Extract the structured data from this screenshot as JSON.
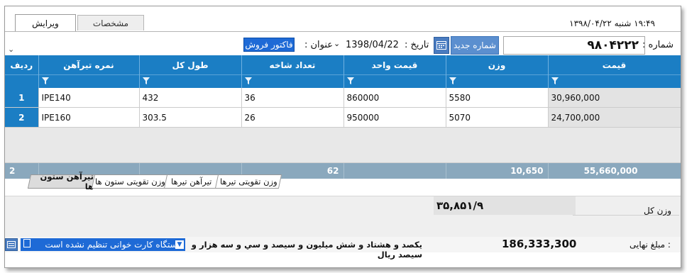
{
  "header": {
    "tabs": [
      {
        "label": "ویرایش",
        "active": true
      },
      {
        "label": "مشخصات",
        "active": false
      }
    ],
    "datetime": "۱۹:۴۹   شنبه  ۱۳۹۸/۰۴/۲۲"
  },
  "form": {
    "number_label": "شماره :",
    "number_value": "۹۸۰۴۲۲۲",
    "new_number_label": "شماره جدید",
    "date_label": "تاریخ :",
    "date_value": "1398/04/22",
    "title_label": "عنوان :",
    "title_value": "فاکتور فروش"
  },
  "grid": {
    "columns": [
      "قیمت",
      "وزن",
      "قیمت واحد",
      "تعداد شاخه",
      "طول کل",
      "نمره تیرآهن",
      "ردیف"
    ],
    "rows": [
      {
        "price": "30,960,000",
        "weight": "5580",
        "unit_price": "860000",
        "count": "36",
        "length": "432",
        "profile": "IPE140",
        "row": "1"
      },
      {
        "price": "24,700,000",
        "weight": "5070",
        "unit_price": "950000",
        "count": "26",
        "length": "303.5",
        "profile": "IPE160",
        "row": "2"
      }
    ],
    "summary": {
      "price": "55,660,000",
      "weight": "10,650",
      "count": "62",
      "row": "2"
    }
  },
  "subtabs": [
    {
      "label": "تیرآهن ستون ها",
      "active": true
    },
    {
      "label": "وزن تقویتی ستون ها",
      "active": false
    },
    {
      "label": "تیرآهن تیرها",
      "active": false
    },
    {
      "label": "وزن تقویتی تیرها",
      "active": false
    }
  ],
  "weight_section": {
    "label": "وزن کل",
    "value": "۳۵,۸۵۱/۹"
  },
  "footer": {
    "final_label": ": مبلغ نهایی",
    "final_value": "186,333,300",
    "amount_words": "یکصد و هشتاد و شش میلیون و سیصد و سي و سه هزار و سیصد ریال",
    "reader_status": "دستگاه کارت خوانی تنظیم نشده است"
  },
  "colors": {
    "header_blue": "#1b7ec4",
    "accent_blue": "#1e6ad6",
    "summary_gray": "#8aa8bd"
  }
}
